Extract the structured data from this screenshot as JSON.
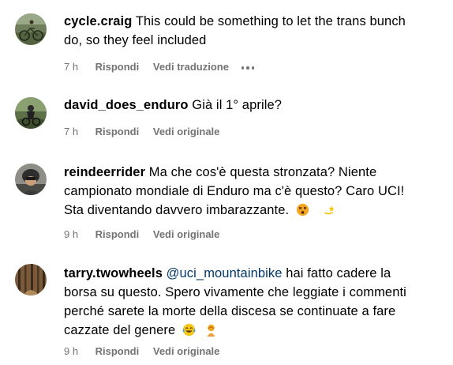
{
  "comments": [
    {
      "username": "cycle.craig",
      "text_line1": "This could be something to let the trans bunch",
      "text_line2": "do, so they feel included",
      "time": "7 h",
      "reply_label": "Rispondi",
      "translate_label": "Vedi traduzione",
      "avatar": "cyclist-with-bike-avatar"
    },
    {
      "username": "david_does_enduro",
      "text": "Già il 1° aprile?",
      "time": "7 h",
      "reply_label": "Rispondi",
      "original_label": "Vedi originale",
      "avatar": "mountain-biker-forest-avatar"
    },
    {
      "username": "reindeerrider",
      "text_line1": "Ma che cos'è questa stronzata? Niente",
      "text_line2": "campionato mondiale di Enduro ma c'è questo? Caro UCI!",
      "text_line3": "Sta diventando davvero imbarazzante.",
      "emojis": [
        "dizzy-face-emoji",
        "dizzy-star-emoji"
      ],
      "time": "9 h",
      "reply_label": "Rispondi",
      "original_label": "Vedi originale",
      "avatar": "rider-helmet-avatar"
    },
    {
      "username": "tarry.twowheels",
      "mention": "@uci_mountainbike",
      "text_line1_rest": "hai fatto cadere la",
      "text_line2": "borsa su questo. Spero vivamente che leggiate i commenti",
      "text_line3": "perché sarete la morte della discesa se continuate a fare",
      "text_line4": "cazzate del genere",
      "emojis": [
        "tears-of-joy-emoji",
        "person-facepalming-emoji"
      ],
      "time": "9 h",
      "reply_label": "Rispondi",
      "original_label": "Vedi originale",
      "avatar": "forest-trail-avatar"
    }
  ],
  "colors": {
    "meta_text": "#737373",
    "mention": "#00376b",
    "body_text": "#000000"
  }
}
